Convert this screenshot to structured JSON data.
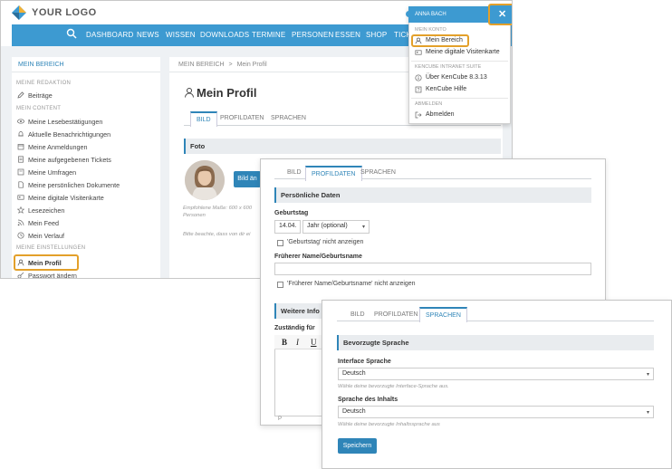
{
  "brand": {
    "logo_text": "YOUR LOGO",
    "accent": "#3d9ad1",
    "highlight": "#e3a02a"
  },
  "nav": {
    "items": [
      "DASHBOARD",
      "NEWS",
      "WISSEN",
      "DOWNLOADS",
      "TERMINE",
      "PERSONEN",
      "ESSEN",
      "SHOP",
      "TICK"
    ]
  },
  "sidebar": {
    "heading": "MEIN BEREICH",
    "cat_redaktion": "MEINE REDAKTION",
    "beitraege": "Beiträge",
    "cat_content": "MEIN CONTENT",
    "content_items": [
      "Meine Lesebestätigungen",
      "Aktuelle Benachrichtigungen",
      "Meine Anmeldungen",
      "Meine aufgegebenen Tickets",
      "Meine Umfragen",
      "Meine persönlichen Dokumente",
      "Meine digitale Visitenkarte",
      "Lesezeichen",
      "Mein Feed",
      "Mein Verlauf"
    ],
    "cat_settings": "MEINE EINSTELLUNGEN",
    "profile": "Mein Profil",
    "password": "Passwort ändern"
  },
  "breadcrumb": {
    "root": "MEIN BEREICH",
    "sep": ">",
    "current": "Mein Profil"
  },
  "profile": {
    "title": "Mein Profil",
    "tabs": [
      "BILD",
      "PROFILDATEN",
      "SPRACHEN"
    ],
    "foto_section": "Foto",
    "upload_button": "Bild än",
    "size_hint": "Empfohlene Maße: 600 x 600",
    "size_hint2": "Personen",
    "note": "Bitte beachte, dass von dir ei"
  },
  "menu": {
    "user": "ANNA BACH",
    "cat_konto": "MEIN KONTO",
    "mein_bereich": "Mein Bereich",
    "visitenkarte": "Meine digitale Visitenkarte",
    "cat_suite": "KENCUBE INTRANET SUITE",
    "ueber": "Über KenCube 8.3.13",
    "hilfe": "KenCube Hilfe",
    "cat_abmelden": "ABMELDEN",
    "abmelden": "Abmelden"
  },
  "profildaten": {
    "tabs": [
      "BILD",
      "PROFILDATEN",
      "SPRACHEN"
    ],
    "section": "Persönliche Daten",
    "geburtstag_label": "Geburtstag",
    "geburtstag_value": "14.04.",
    "jahr_value": "Jahr (optional)",
    "hide_birthday": "'Geburtstag' nicht anzeigen",
    "former_label": "Früherer Name/Geburtsname",
    "hide_former": "'Früherer Name/Geburtsname' nicht anzeigen",
    "section2": "Weitere Info",
    "zustaendig": "Zuständig für",
    "editor_footer": "P"
  },
  "sprachen": {
    "tabs": [
      "BILD",
      "PROFILDATEN",
      "SPRACHEN"
    ],
    "section": "Bevorzugte Sprache",
    "interface_label": "Interface Sprache",
    "interface_value": "Deutsch",
    "interface_hint": "Wähle deine bevorzugte Interface-Sprache aus.",
    "content_label": "Sprache des Inhalts",
    "content_value": "Deutsch",
    "content_hint": "Wähle deine bevorzugte Inhaltssprache aus",
    "save": "Speichern"
  }
}
